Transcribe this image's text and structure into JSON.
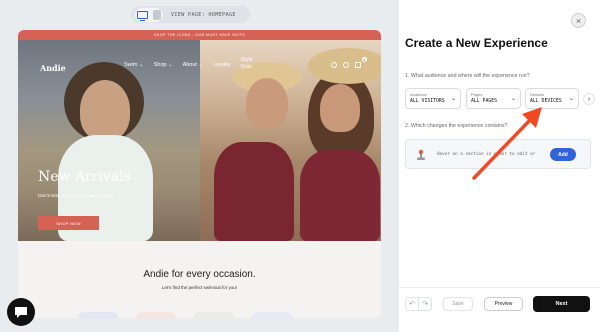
{
  "view_bar": {
    "label": "VIEW PAGE: HOMEPAGE"
  },
  "site": {
    "promo": "SHOP THE ICONS - OUR MUST HAVE SUITS",
    "brand": "Andie",
    "nav": [
      "Swim ⌄",
      "Shop ⌄",
      "About ⌄",
      "Loyalty"
    ],
    "nav_stacked": [
      "Style",
      "Quiz"
    ],
    "cart_count": "0",
    "hero_title": "New Arrivals",
    "hero_sub": "Don't miss out on our newest styles.",
    "shop_button": "SHOP NOW",
    "occasion_title": "Andie for every occasion.",
    "occasion_sub": "Let's find the perfect swimsuit for you!"
  },
  "panel": {
    "title": "Create a New Experience",
    "q1": "1. What audience and where will the experience run?",
    "selects": [
      {
        "label": "Audience",
        "value": "ALL VISITORS"
      },
      {
        "label": "Pages",
        "value": "ALL PAGES"
      },
      {
        "label": "Devices",
        "value": "ALL DEVICES"
      }
    ],
    "scroll_glyph": "›",
    "q2": "2. Which changes the experience contains?",
    "hover_text": "Hover on a section in order to edit or",
    "add_label": "Add",
    "save_label": "Save",
    "preview_label": "Preview",
    "next_label": "Next",
    "close_glyph": "×",
    "undo_glyph": "↶",
    "redo_glyph": "↷"
  },
  "colors": {
    "promo": "#d66255",
    "accent_blue": "#2f63d6",
    "arrow": "#f04a24",
    "next_button": "#111111"
  },
  "icons": {
    "view_toggle": [
      "desktop-icon",
      "mobile-icon"
    ],
    "nav": [
      "search-icon",
      "account-icon",
      "bag-icon"
    ],
    "chat": "chat-icon",
    "hover": "joystick-icon"
  }
}
